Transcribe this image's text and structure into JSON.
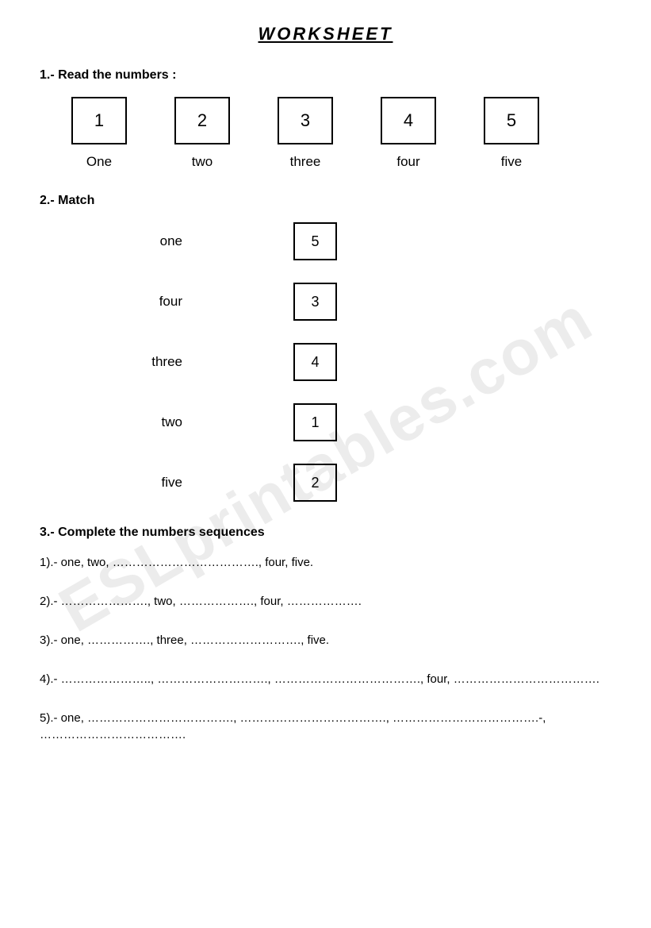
{
  "title": "WORKSHEET",
  "section1": {
    "label": "1.- Read the numbers :",
    "items": [
      {
        "digit": "1",
        "word": "One"
      },
      {
        "digit": "2",
        "word": "two"
      },
      {
        "digit": "3",
        "word": "three"
      },
      {
        "digit": "4",
        "word": "four"
      },
      {
        "digit": "5",
        "word": "five"
      }
    ]
  },
  "section2": {
    "label": "2.- Match",
    "rows": [
      {
        "word": "one",
        "box": "5"
      },
      {
        "word": "four",
        "box": "3"
      },
      {
        "word": "three",
        "box": "4"
      },
      {
        "word": "two",
        "box": "1"
      },
      {
        "word": "five",
        "box": "2"
      }
    ]
  },
  "section3": {
    "label": "3.- Complete the numbers sequences",
    "lines": [
      "1).- one, two, ………………………………., four, five.",
      "2).- …………………., two, ………………., four, ……………….",
      "3).- one, ……………., three, ………………………., five.",
      "4).- ………………….., ………………………., ………………………………., four, ……………………………….",
      "5).- one, ………………………………., ………………………………., ……………………………….-,  ………………………………."
    ]
  },
  "watermark": "ESLprintables.com"
}
